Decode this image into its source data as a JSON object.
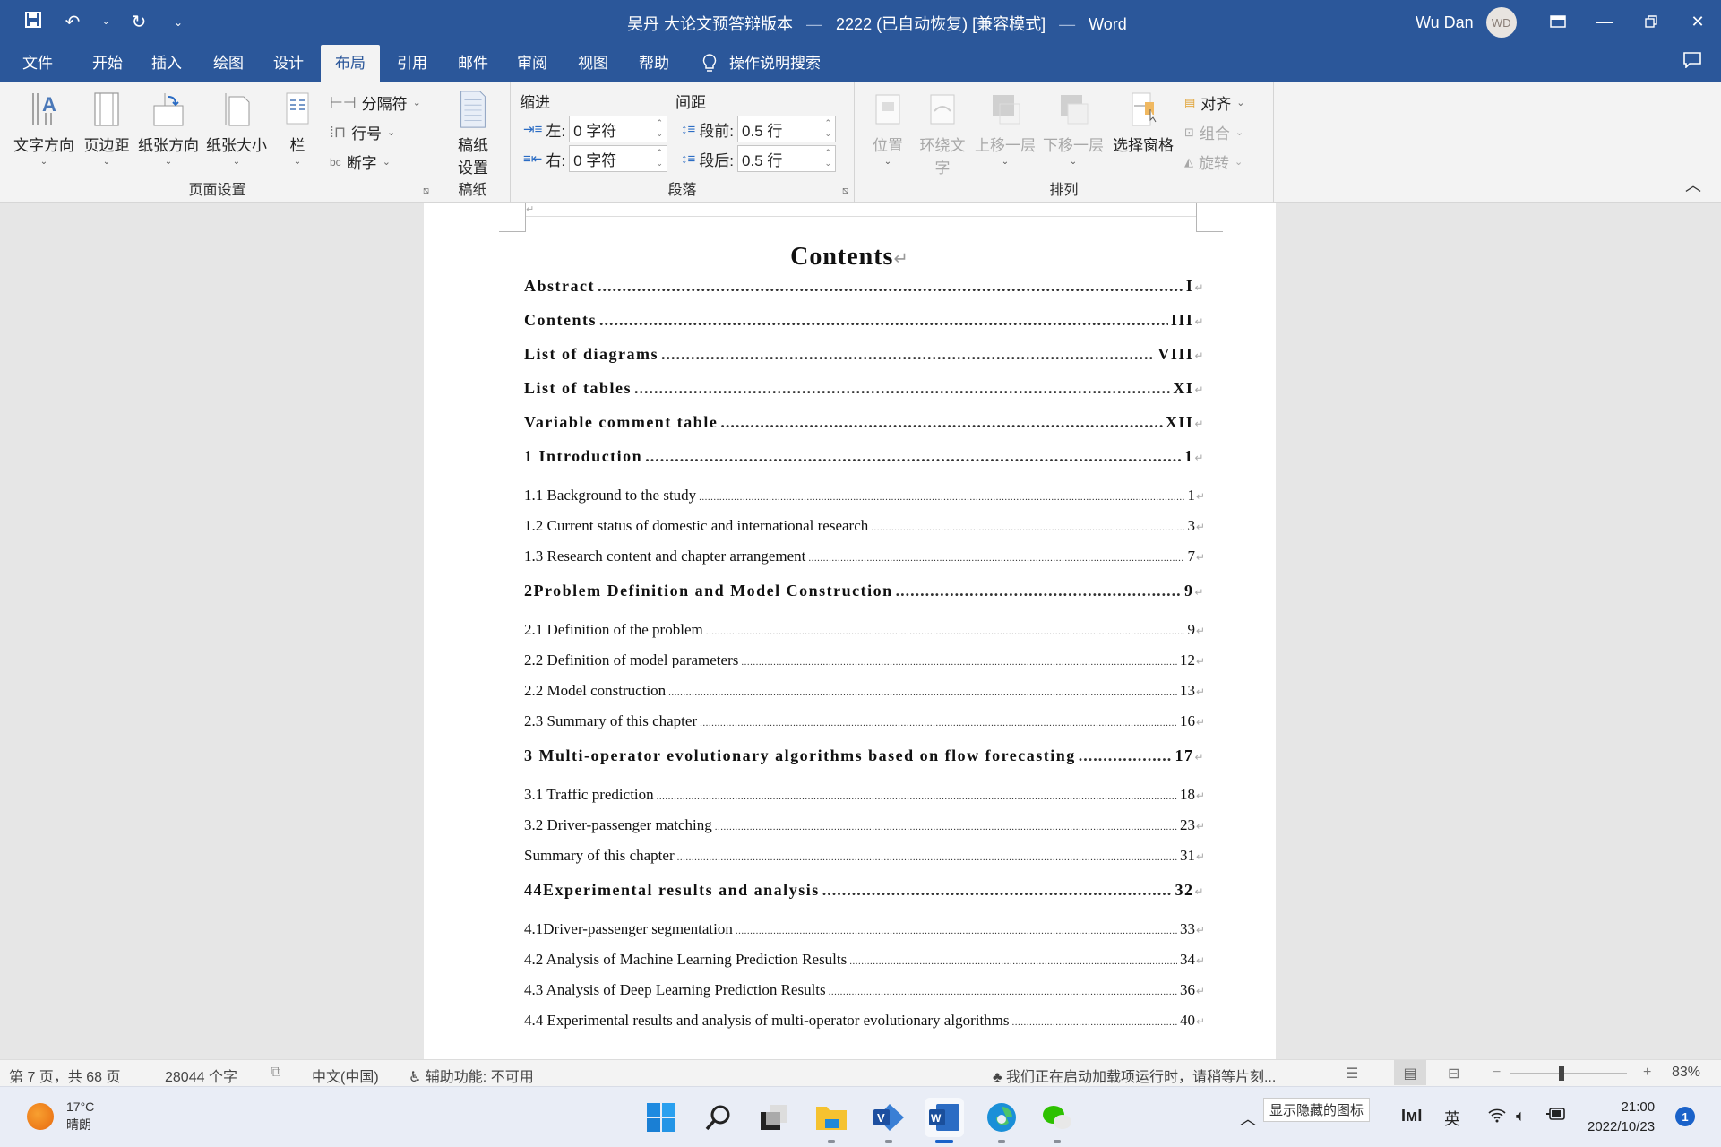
{
  "titlebar": {
    "doc_name": "吴丹 大论文预答辩版本",
    "doc_version": "2222 (已自动恢复) [兼容模式]",
    "app_name": "Word",
    "user_name": "Wu Dan",
    "user_initials": "WD",
    "qat": {
      "save": "save-icon",
      "undo": "undo-icon",
      "redo": "redo-icon",
      "customize": "customize-icon"
    }
  },
  "tabs": [
    {
      "label": "文件",
      "active": false
    },
    {
      "label": "开始",
      "active": false
    },
    {
      "label": "插入",
      "active": false
    },
    {
      "label": "绘图",
      "active": false
    },
    {
      "label": "设计",
      "active": false
    },
    {
      "label": "布局",
      "active": true
    },
    {
      "label": "引用",
      "active": false
    },
    {
      "label": "邮件",
      "active": false
    },
    {
      "label": "审阅",
      "active": false
    },
    {
      "label": "视图",
      "active": false
    },
    {
      "label": "帮助",
      "active": false
    }
  ],
  "tell_me": "操作说明搜索",
  "ribbon": {
    "page_setup": {
      "label": "页面设置",
      "text_direction": "文字方向",
      "margins": "页边距",
      "orientation": "纸张方向",
      "size": "纸张大小",
      "columns": "栏",
      "breaks": "分隔符",
      "line_numbers": "行号",
      "hyphenation": "断字"
    },
    "manuscript": {
      "label": "稿纸",
      "setup_line1": "稿纸",
      "setup_line2": "设置"
    },
    "paragraph": {
      "label": "段落",
      "indent_heading": "缩进",
      "spacing_heading": "间距",
      "indent_left_label": "左:",
      "indent_left_value": "0 字符",
      "indent_right_label": "右:",
      "indent_right_value": "0 字符",
      "spacing_before_label": "段前:",
      "spacing_before_value": "0.5 行",
      "spacing_after_label": "段后:",
      "spacing_after_value": "0.5 行"
    },
    "arrange": {
      "label": "排列",
      "position": "位置",
      "wrap_text_1": "环绕文",
      "wrap_text_2": "字",
      "bring_forward": "上移一层",
      "send_backward": "下移一层",
      "selection_pane": "选择窗格",
      "align": "对齐",
      "group": "组合",
      "rotate": "旋转"
    }
  },
  "document": {
    "toc_title": "Contents",
    "entries": [
      {
        "level": 1,
        "text": "Abstract",
        "page": "I"
      },
      {
        "level": 1,
        "text": "Contents",
        "page": "III"
      },
      {
        "level": 1,
        "text": "List of diagrams",
        "page": "VIII"
      },
      {
        "level": 1,
        "text": "List of tables",
        "page": "XI"
      },
      {
        "level": 1,
        "text": "Variable comment table",
        "page": "XII"
      },
      {
        "level": 1,
        "text": "1 Introduction",
        "page": "1"
      },
      {
        "level": 2,
        "text": "1.1 Background to the study",
        "page": "1"
      },
      {
        "level": 2,
        "text": "1.2 Current status of domestic and international research",
        "page": "3"
      },
      {
        "level": 2,
        "text": "1.3 Research content and chapter arrangement",
        "page": "7"
      },
      {
        "level": 1,
        "text": "2Problem Definition and Model Construction",
        "page": "9"
      },
      {
        "level": 2,
        "text": "2.1 Definition of the problem",
        "page": "9"
      },
      {
        "level": 2,
        "text": "2.2 Definition of model parameters",
        "page": "12"
      },
      {
        "level": 2,
        "text": "2.2 Model construction",
        "page": "13"
      },
      {
        "level": 2,
        "text": "2.3 Summary of this chapter",
        "page": "16"
      },
      {
        "level": 1,
        "text": "3 Multi-operator evolutionary algorithms based on flow forecasting",
        "page": "17"
      },
      {
        "level": 2,
        "text": "3.1 Traffic prediction",
        "page": "18"
      },
      {
        "level": 2,
        "text": "3.2 Driver-passenger matching",
        "page": "23"
      },
      {
        "level": 2,
        "text": "Summary of this chapter",
        "page": "31"
      },
      {
        "level": 1,
        "text": "44Experimental results and analysis",
        "page": "32"
      },
      {
        "level": 2,
        "text": "4.1Driver-passenger segmentation",
        "page": "33"
      },
      {
        "level": 2,
        "text": "4.2 Analysis of Machine Learning Prediction Results",
        "page": "34"
      },
      {
        "level": 2,
        "text": "4.3 Analysis of Deep Learning Prediction Results",
        "page": "36"
      },
      {
        "level": 2,
        "text": "4.4 Experimental results and analysis of multi-operator evolutionary algorithms",
        "page": "40"
      }
    ]
  },
  "statusbar": {
    "page_info": "第 7 页，共 68 页",
    "word_count": "28044 个字",
    "language": "中文(中国)",
    "accessibility": "辅助功能: 不可用",
    "addin_message": "我们正在启动加载项运行时，请稍等片刻...",
    "zoom_minus": "−",
    "zoom_plus": "+",
    "zoom_level": "83%"
  },
  "taskbar": {
    "weather_temp": "17°C",
    "weather_desc": "晴朗",
    "tooltip": "显示隐藏的图标",
    "ime_mode": "英",
    "time": "21:00",
    "date": "2022/10/23",
    "notification_count": "1",
    "apps": [
      "start",
      "search",
      "task-view",
      "file-explorer",
      "visio",
      "word",
      "edge",
      "wechat"
    ]
  },
  "colors": {
    "word_blue": "#2b579a",
    "ribbon_bg": "#f3f3f3",
    "taskbar_bg": "#e9edf6",
    "accent": "#1a62c9"
  }
}
